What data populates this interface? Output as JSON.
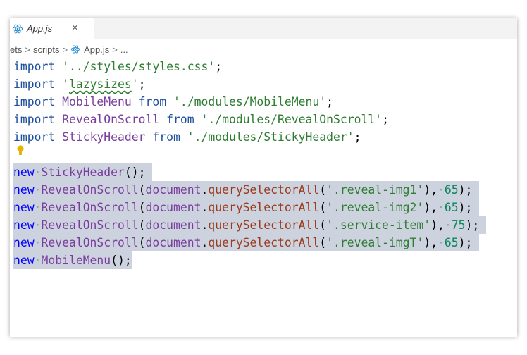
{
  "tab": {
    "filename": "App.js",
    "close_glyph": "×",
    "icon": "react-icon"
  },
  "breadcrumb": {
    "seg1": "ets",
    "seg2": "scripts",
    "seg3": "App.js",
    "seg4": "...",
    "sep": ">"
  },
  "code": {
    "l1": {
      "kw": "import",
      "sp": " ",
      "str": "'../styles/styles.css'",
      "end": ";"
    },
    "l2": {
      "kw": "import",
      "sp": " ",
      "q1": "'",
      "pkg": "lazysizes",
      "q2": "'",
      "end": ";"
    },
    "l3": {
      "kw": "import",
      "name": "MobileMenu",
      "from": "from",
      "str": "'./modules/MobileMenu'",
      "end": ";"
    },
    "l4": {
      "kw": "import",
      "name": "RevealOnScroll",
      "from": "from",
      "str": "'./modules/RevealOnScroll'",
      "end": ";"
    },
    "l5": {
      "kw": "import",
      "name": "StickyHeader",
      "from": "from",
      "str": "'./modules/StickyHeader'",
      "end": ";"
    },
    "l7": {
      "new": "new",
      "dot": "·",
      "cls": "StickyHeader",
      "end": "();"
    },
    "l8": {
      "new": "new",
      "cls": "RevealOnScroll",
      "obj": "document",
      "meth": "querySelectorAll",
      "str": "'.reveal-img1'",
      "num": "65"
    },
    "l9": {
      "new": "new",
      "cls": "RevealOnScroll",
      "obj": "document",
      "meth": "querySelectorAll",
      "str": "'.reveal-img2'",
      "num": "65"
    },
    "l10": {
      "new": "new",
      "cls": "RevealOnScroll",
      "obj": "document",
      "meth": "querySelectorAll",
      "str": "'.service-item'",
      "num": "75"
    },
    "l11": {
      "new": "new",
      "cls": "RevealOnScroll",
      "obj": "document",
      "meth": "querySelectorAll",
      "str": "'.reveal-imgT'",
      "num": "65"
    },
    "l12": {
      "new": "new",
      "cls": "MobileMenu",
      "end": "();"
    },
    "p_open": "(",
    "p_dot": ".",
    "p_open2": "(",
    "p_close": ")",
    "p_comma": ",",
    "p_end": ");"
  },
  "colors": {
    "selection": "#cdd3de",
    "keyword": "#0000ff",
    "string": "#a31515"
  }
}
